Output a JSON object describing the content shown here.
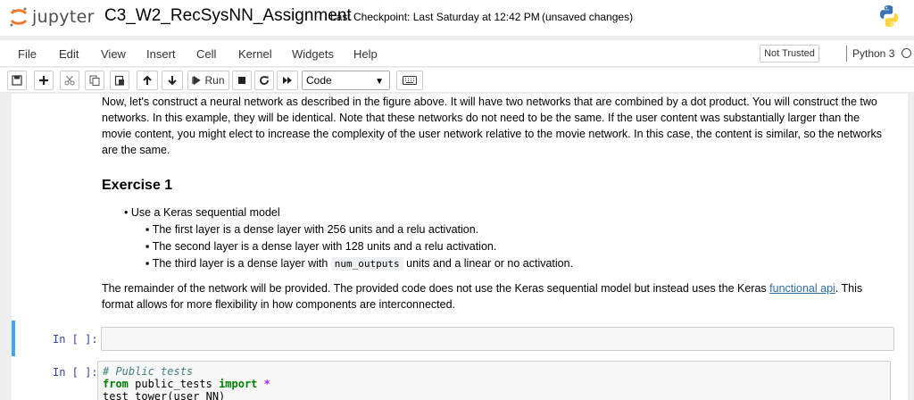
{
  "header": {
    "logo_text": "jupyter",
    "notebook_title": "C3_W2_RecSysNN_Assignment",
    "checkpoint": "Last Checkpoint: Last Saturday at 12:42 PM",
    "save_status": "(unsaved changes)"
  },
  "menubar": {
    "items": [
      "File",
      "Edit",
      "View",
      "Insert",
      "Cell",
      "Kernel",
      "Widgets",
      "Help"
    ],
    "trust": "Not Trusted",
    "kernel": "Python 3"
  },
  "toolbar": {
    "run_label": "Run",
    "cell_type": "Code"
  },
  "content": {
    "intro": "Now, let's construct a neural network as described in the figure above. It will have two networks that are combined by a dot product. You will construct the two networks. In this example, they will be identical. Note that these networks do not need to be the same. If the user content was substantially larger than the movie content, you might elect to increase the complexity of the user network relative to the movie network. In this case, the content is similar, so the networks are the same.",
    "exercise_title": "Exercise 1",
    "bullet": "Use a Keras sequential model",
    "sub1": "The first layer is a dense layer with 256 units and a relu activation.",
    "sub2": "The second layer is a dense layer with 128 units and a relu activation.",
    "sub3_pre": "The third layer is a dense layer with",
    "sub3_code": "num_outputs",
    "sub3_post": "units and a linear or no activation.",
    "remainder_pre": "The remainder of the network will be provided. The provided code does not use the Keras sequential model but instead uses the Keras",
    "remainder_link": "functional api",
    "remainder_post": ". This format allows for more flexibility in how components are interconnected."
  },
  "cells": {
    "prompt1": "In [ ]:",
    "prompt2": "In [ ]:",
    "code2_line1": "# Public tests",
    "code2_from": "from",
    "code2_module": " public_tests ",
    "code2_import": "import",
    "code2_star": " *",
    "code2_line3": "test_tower(user_NN)"
  }
}
